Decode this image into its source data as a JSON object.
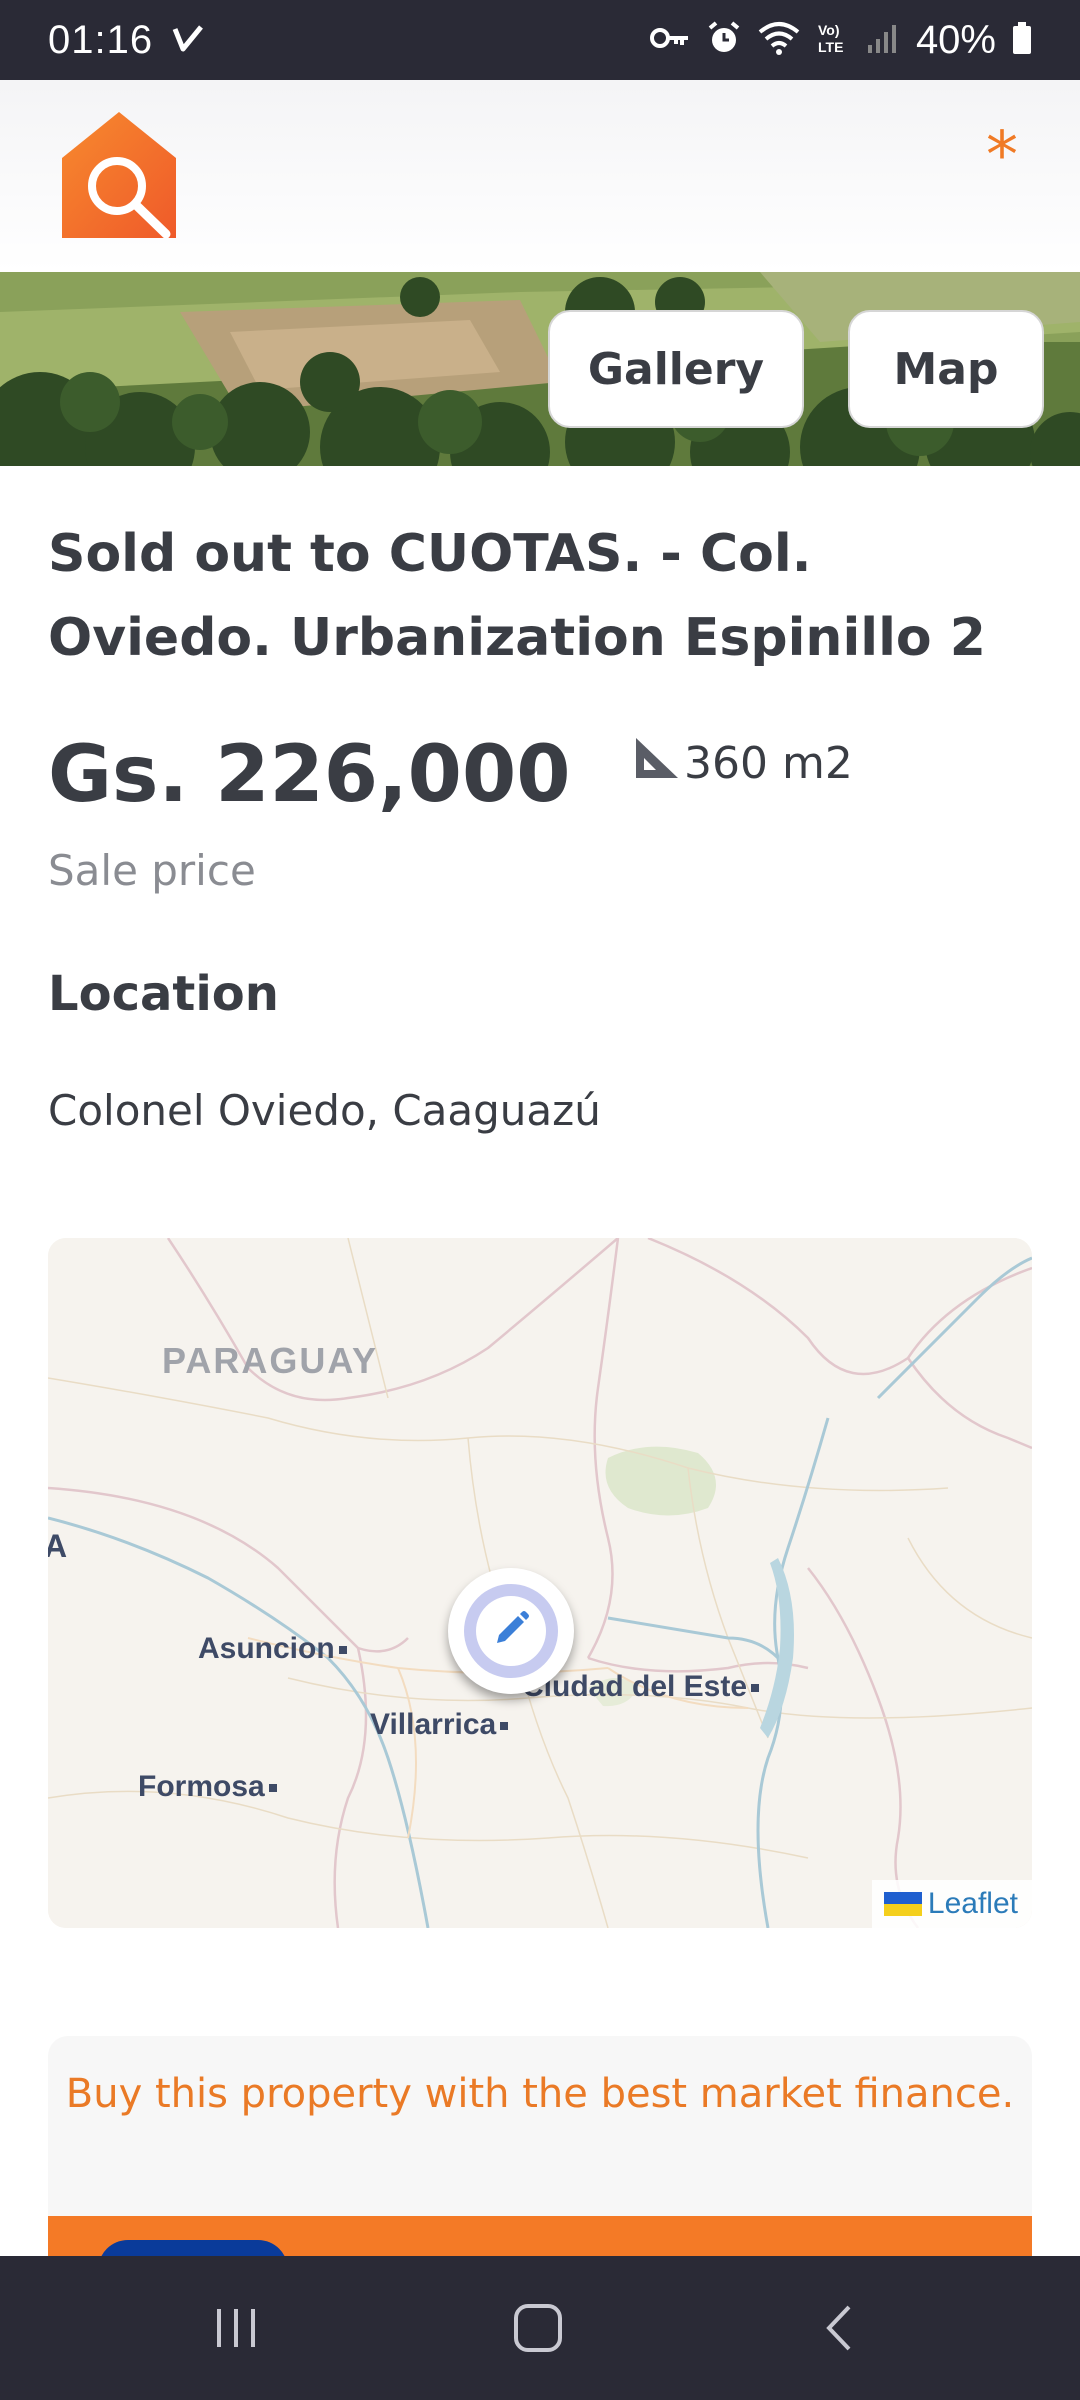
{
  "status_bar": {
    "time": "01:16",
    "battery": "40%",
    "icons": [
      "check-icon",
      "key-icon",
      "alarm-icon",
      "wifi-icon",
      "volte-icon",
      "signal-icon",
      "battery-icon"
    ]
  },
  "header": {
    "logo": "house-search-logo",
    "menu_symbol": "*",
    "accent_color": "#f07a25"
  },
  "hero": {
    "gallery_label": "Gallery",
    "map_label": "Map"
  },
  "listing": {
    "title": "Sold out to CUOTAS. - Col. Oviedo. Urbanization Espinillo 2",
    "price": "Gs. 226,000",
    "price_label": "Sale price",
    "area": "360 m2",
    "location_heading": "Location",
    "location": "Colonel Oviedo, Caaguazú"
  },
  "map": {
    "country_label": "PARAGUAY",
    "edge_label": "A",
    "cities": [
      "Asuncion",
      "Villarrica",
      "Formosa",
      "Ciudad del Este"
    ],
    "marker_icon": "pencil-icon",
    "attribution": "Leaflet"
  },
  "finance": {
    "text": "Buy this property with the best market finance.",
    "accent_color": "#f47a26"
  },
  "nav": {
    "icons": [
      "recent-apps-icon",
      "home-icon",
      "back-icon"
    ]
  }
}
